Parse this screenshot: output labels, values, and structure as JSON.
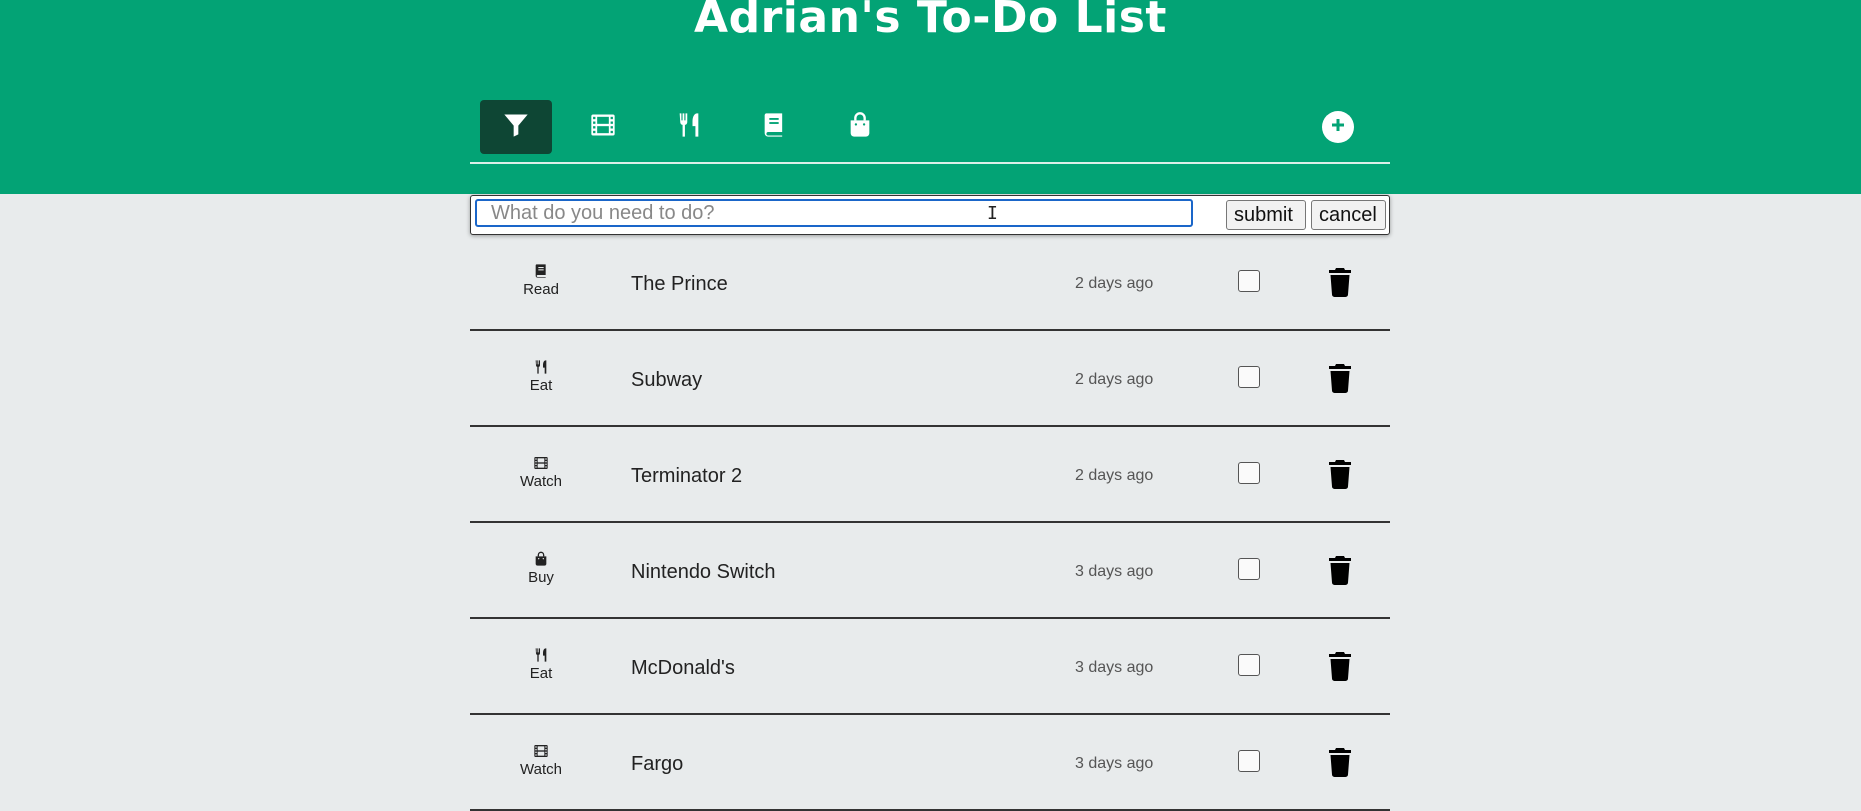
{
  "app": {
    "title": "Adrian's To-Do List"
  },
  "filters": [
    {
      "name": "filter-all",
      "icon": "filter-icon",
      "active": true
    },
    {
      "name": "filter-watch",
      "icon": "film-icon",
      "active": false
    },
    {
      "name": "filter-eat",
      "icon": "utensils-icon",
      "active": false
    },
    {
      "name": "filter-read",
      "icon": "book-icon",
      "active": false
    },
    {
      "name": "filter-buy",
      "icon": "shopping-bag-icon",
      "active": false
    }
  ],
  "add_button": {
    "icon": "plus-circle-icon"
  },
  "form": {
    "placeholder": "What do you need to do?",
    "value": "",
    "submit_label": "submit",
    "cancel_label": "cancel"
  },
  "tasks": [
    {
      "category": "Read",
      "icon": "book-icon",
      "title": "The Prince",
      "time": "2 days ago",
      "done": false
    },
    {
      "category": "Eat",
      "icon": "utensils-icon",
      "title": "Subway",
      "time": "2 days ago",
      "done": false
    },
    {
      "category": "Watch",
      "icon": "film-icon",
      "title": "Terminator 2",
      "time": "2 days ago",
      "done": false
    },
    {
      "category": "Buy",
      "icon": "shopping-bag-icon",
      "title": "Nintendo Switch",
      "time": "3 days ago",
      "done": false
    },
    {
      "category": "Eat",
      "icon": "utensils-icon",
      "title": "McDonald's",
      "time": "3 days ago",
      "done": false
    },
    {
      "category": "Watch",
      "icon": "film-icon",
      "title": "Fargo",
      "time": "3 days ago",
      "done": false
    }
  ],
  "colors": {
    "header_bg": "#03a375",
    "active_filter_bg": "#0e4634",
    "page_bg": "#e8ebec",
    "focus_border": "#1a66c9"
  }
}
